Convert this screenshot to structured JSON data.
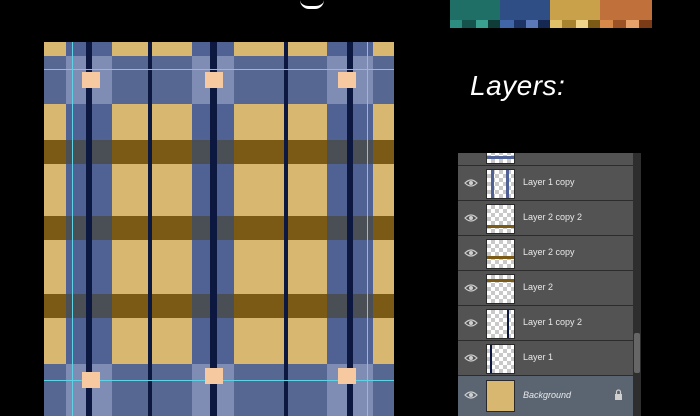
{
  "heading": "Layers:",
  "palette": {
    "teal": "#1f6f66",
    "blue": "#2f4e86",
    "gold": "#c9a14a",
    "orange": "#c0703a",
    "plaid_base": "#d8b870",
    "plaid_blue": "#4f6293",
    "plaid_dark": "#0c1840",
    "plaid_brown": "#7a5a14",
    "guide": "#5fd3e6",
    "node": "#f7c9a0"
  },
  "layers": [
    {
      "name": "Layer 1 copy",
      "icon": "eye-icon"
    },
    {
      "name": "Layer 2 copy 2",
      "icon": "eye-icon"
    },
    {
      "name": "Layer 2 copy",
      "icon": "eye-icon"
    },
    {
      "name": "Layer 2",
      "icon": "eye-icon"
    },
    {
      "name": "Layer 1 copy 2",
      "icon": "eye-icon"
    },
    {
      "name": "Layer 1",
      "icon": "eye-icon"
    },
    {
      "name": "Background",
      "icon": "eye-icon",
      "locked": true,
      "selected": true
    }
  ]
}
